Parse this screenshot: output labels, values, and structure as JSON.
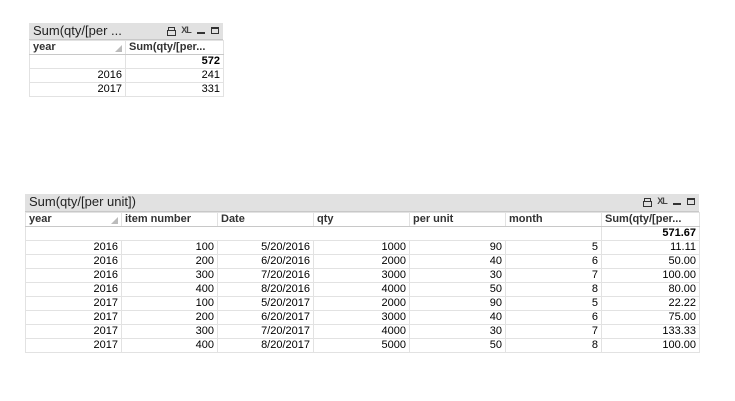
{
  "small_table": {
    "title": "Sum(qty/[per ...",
    "tools": {
      "print": "printer-icon",
      "xl": "XL",
      "minimize": "minimize-icon",
      "maximize": "maximize-icon"
    },
    "headers": [
      "year",
      "Sum(qty/[per..."
    ],
    "total": "572",
    "rows": [
      [
        "2016",
        "241"
      ],
      [
        "2017",
        "331"
      ]
    ]
  },
  "big_table": {
    "title": "Sum(qty/[per unit])",
    "tools": {
      "print": "printer-icon",
      "xl": "XL",
      "minimize": "minimize-icon",
      "maximize": "maximize-icon"
    },
    "headers": [
      "year",
      "item number",
      "Date",
      "qty",
      "per unit",
      "month",
      "Sum(qty/[per..."
    ],
    "total": "571.67",
    "rows": [
      [
        "2016",
        "100",
        "5/20/2016",
        "1000",
        "90",
        "5",
        "11.11"
      ],
      [
        "2016",
        "200",
        "6/20/2016",
        "2000",
        "40",
        "6",
        "50.00"
      ],
      [
        "2016",
        "300",
        "7/20/2016",
        "3000",
        "30",
        "7",
        "100.00"
      ],
      [
        "2016",
        "400",
        "8/20/2016",
        "4000",
        "50",
        "8",
        "80.00"
      ],
      [
        "2017",
        "100",
        "5/20/2017",
        "2000",
        "90",
        "5",
        "22.22"
      ],
      [
        "2017",
        "200",
        "6/20/2017",
        "3000",
        "40",
        "6",
        "75.00"
      ],
      [
        "2017",
        "300",
        "7/20/2017",
        "4000",
        "30",
        "7",
        "133.33"
      ],
      [
        "2017",
        "400",
        "8/20/2017",
        "5000",
        "50",
        "8",
        "100.00"
      ]
    ]
  }
}
